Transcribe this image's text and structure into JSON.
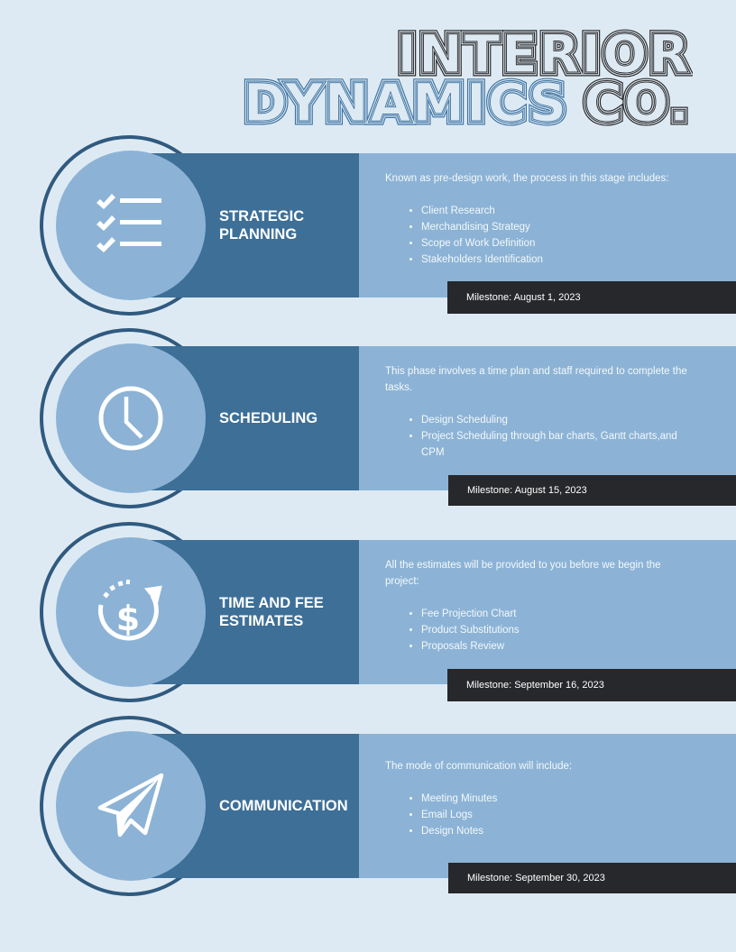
{
  "header": {
    "title_line1": "INTERIOR",
    "title_line2_accent": "DYNAMICS",
    "title_line2_rest": "CO."
  },
  "colors": {
    "background": "#deeaf3",
    "ring": "#305a7f",
    "dark_block": "#3d6f97",
    "light_block": "#8cb3d6",
    "milestone_bar": "#27282b",
    "title_dark": "#2a2a2c",
    "title_accent": "#3f74a3"
  },
  "stages": [
    {
      "icon": "checklist-icon",
      "title_lines": [
        "STRATEGIC",
        "PLANNING"
      ],
      "intro": "Known as pre-design work, the process in this stage includes:",
      "items": [
        "Client Research",
        "Merchandising Strategy",
        "Scope of Work Definition",
        "Stakeholders Identification"
      ],
      "milestone": "Milestone: August 1, 2023"
    },
    {
      "icon": "clock-icon",
      "title_lines": [
        "SCHEDULING"
      ],
      "intro": "This phase involves a time plan and staff required to complete the tasks.",
      "items": [
        "Design Scheduling",
        "Project Scheduling through bar charts, Gantt charts,and CPM"
      ],
      "milestone": "Milestone: August 15, 2023"
    },
    {
      "icon": "dollar-cycle-icon",
      "title_lines": [
        "TIME AND FEE",
        "ESTIMATES"
      ],
      "intro": "All the estimates will be provided to you before we begin the project:",
      "items": [
        "Fee Projection Chart",
        "Product Substitutions",
        "Proposals Review"
      ],
      "milestone": "Milestone: September 16, 2023"
    },
    {
      "icon": "paper-plane-icon",
      "title_lines": [
        "COMMUNICATION"
      ],
      "intro": "The mode of communication will include:",
      "items": [
        "Meeting Minutes",
        "Email Logs",
        "Design Notes"
      ],
      "milestone": "Milestone: September 30, 2023"
    }
  ]
}
